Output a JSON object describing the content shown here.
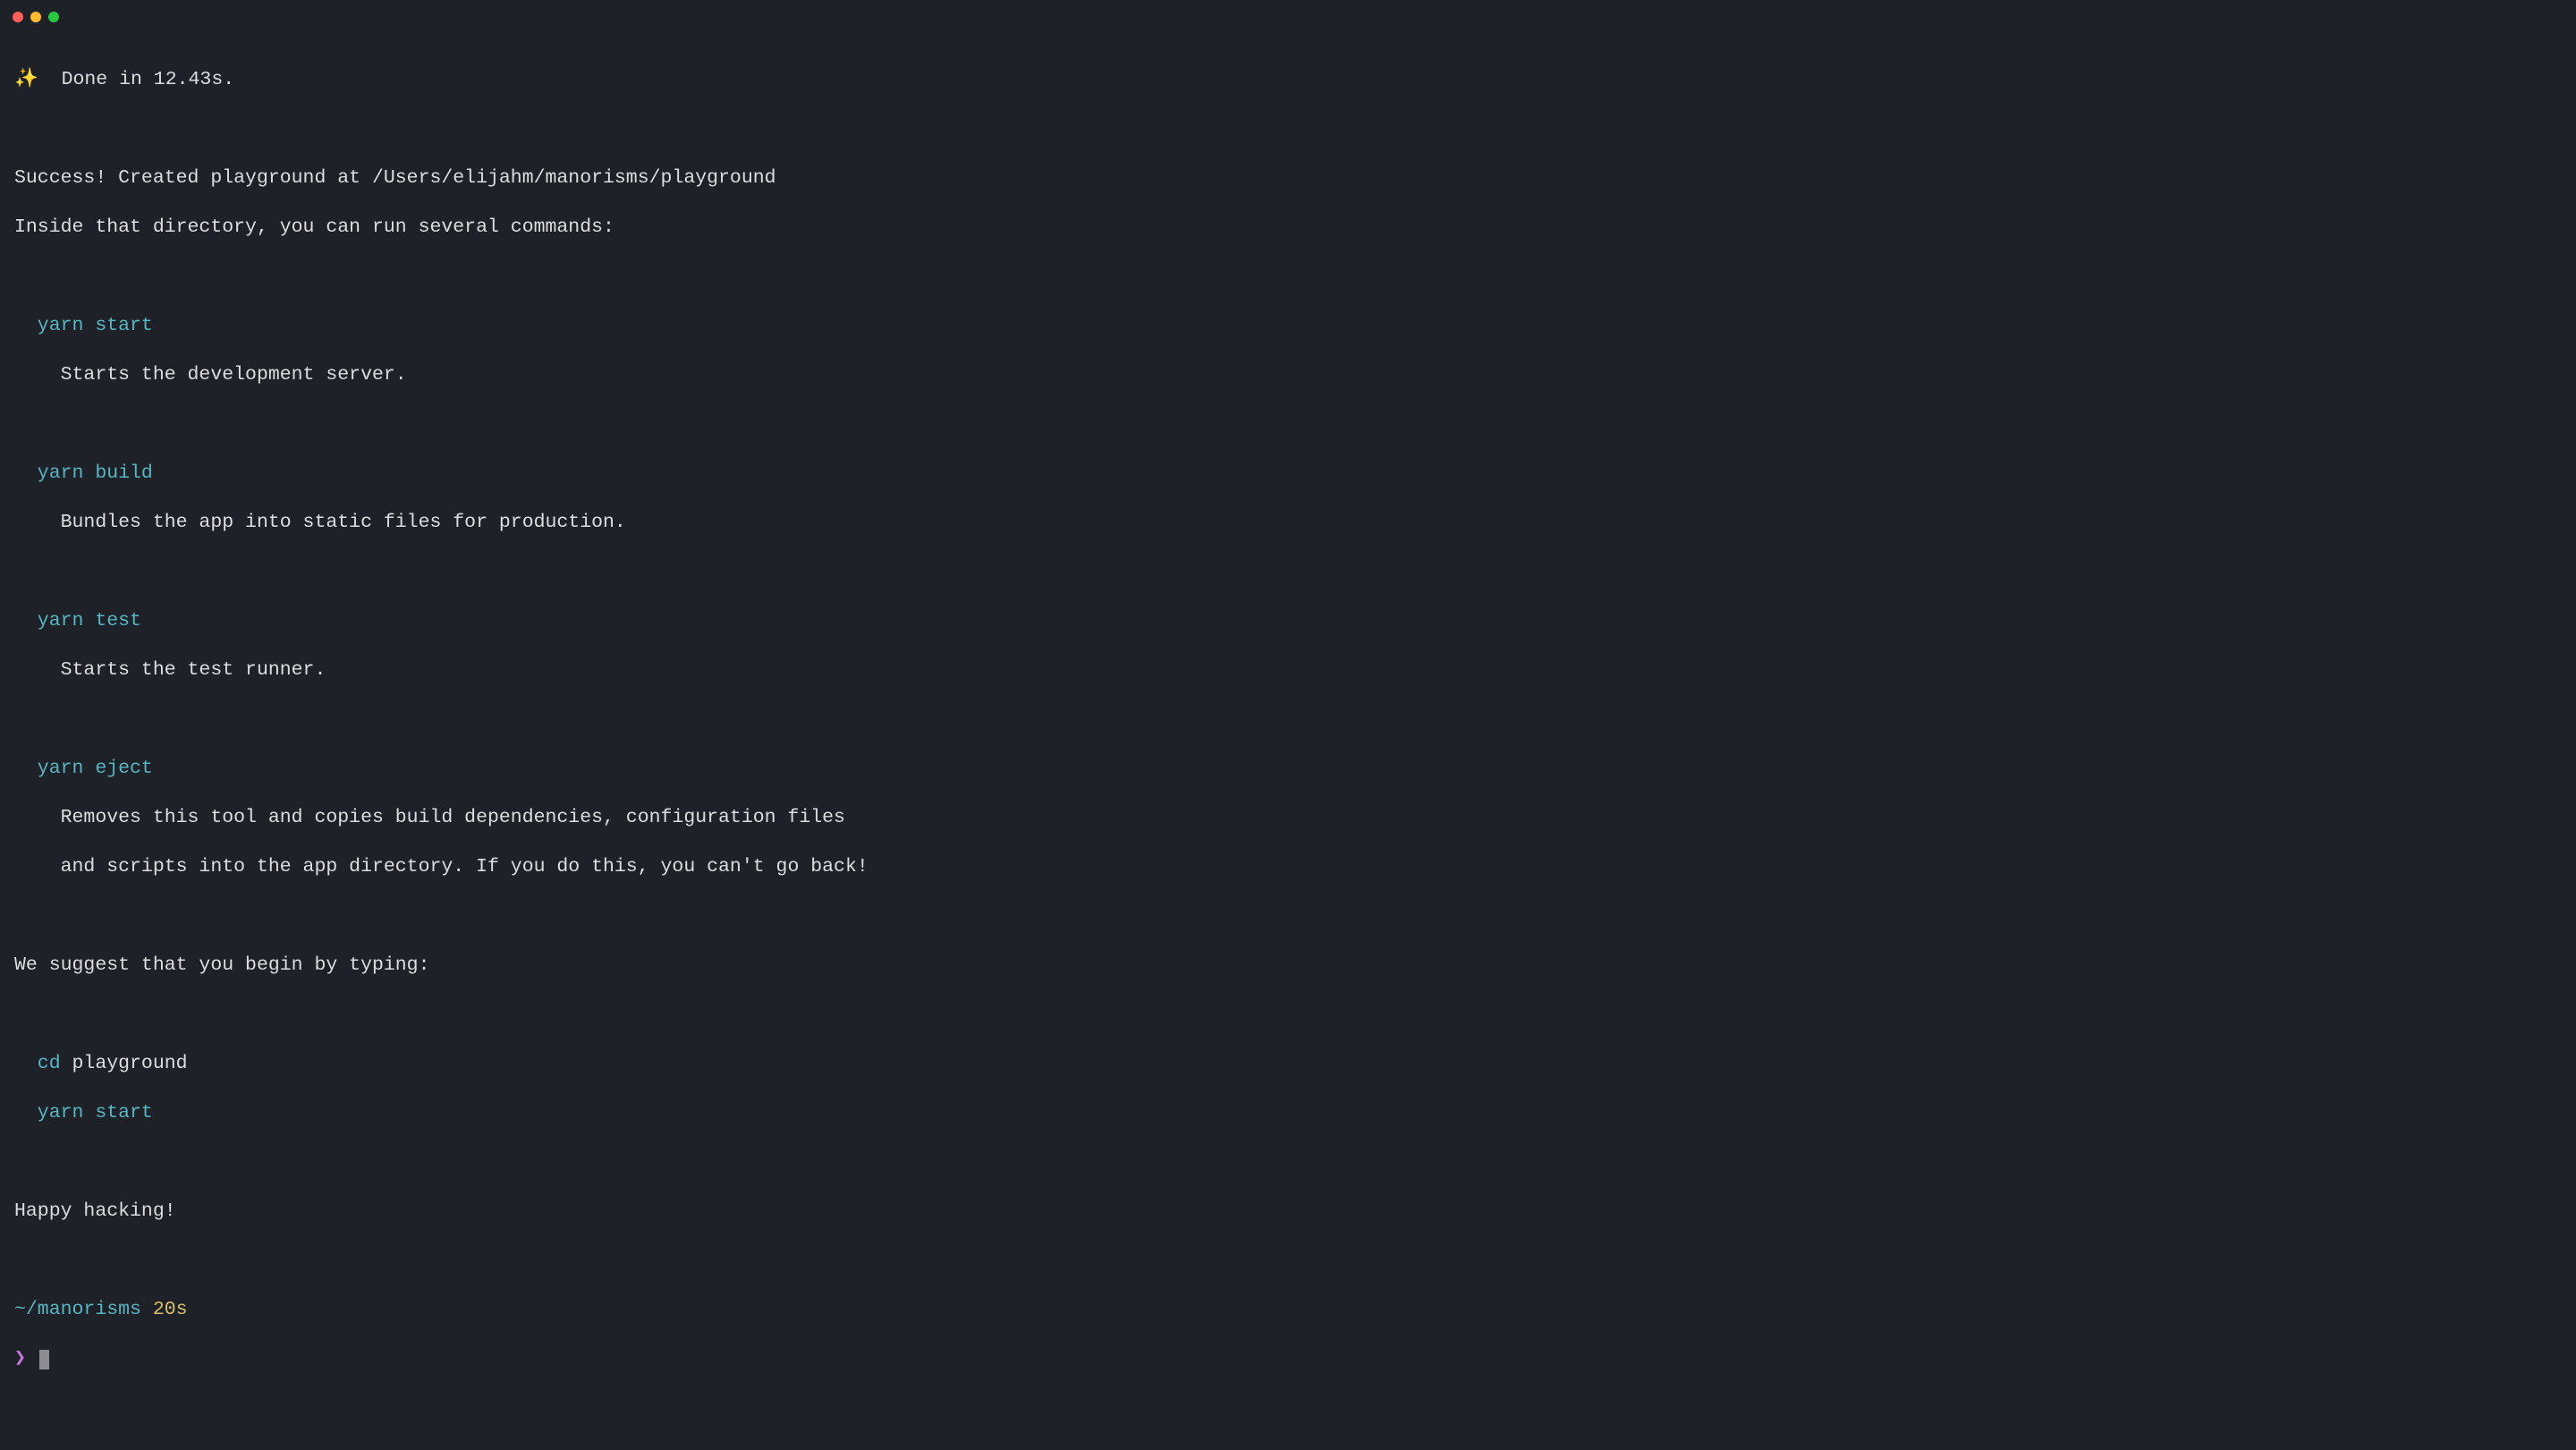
{
  "output": {
    "sparkle": "✨",
    "done_line": "  Done in 12.43s.",
    "success_line": "Success! Created playground at /Users/elijahm/manorisms/playground",
    "inside_line": "Inside that directory, you can run several commands:",
    "cmd_start": "  yarn start",
    "cmd_start_desc": "    Starts the development server.",
    "cmd_build": "  yarn build",
    "cmd_build_desc": "    Bundles the app into static files for production.",
    "cmd_test": "  yarn test",
    "cmd_test_desc": "    Starts the test runner.",
    "cmd_eject": "  yarn eject",
    "cmd_eject_desc1": "    Removes this tool and copies build dependencies, configuration files",
    "cmd_eject_desc2": "    and scripts into the app directory. If you do this, you can't go back!",
    "suggest_line": "We suggest that you begin by typing:",
    "cd_cmd_prefix": "  cd",
    "cd_cmd_arg": " playground",
    "yarn_start2": "  yarn start",
    "happy": "Happy hacking!"
  },
  "prompt": {
    "cwd": "~/manorisms",
    "time": " 20s",
    "symbol": "❯ "
  }
}
